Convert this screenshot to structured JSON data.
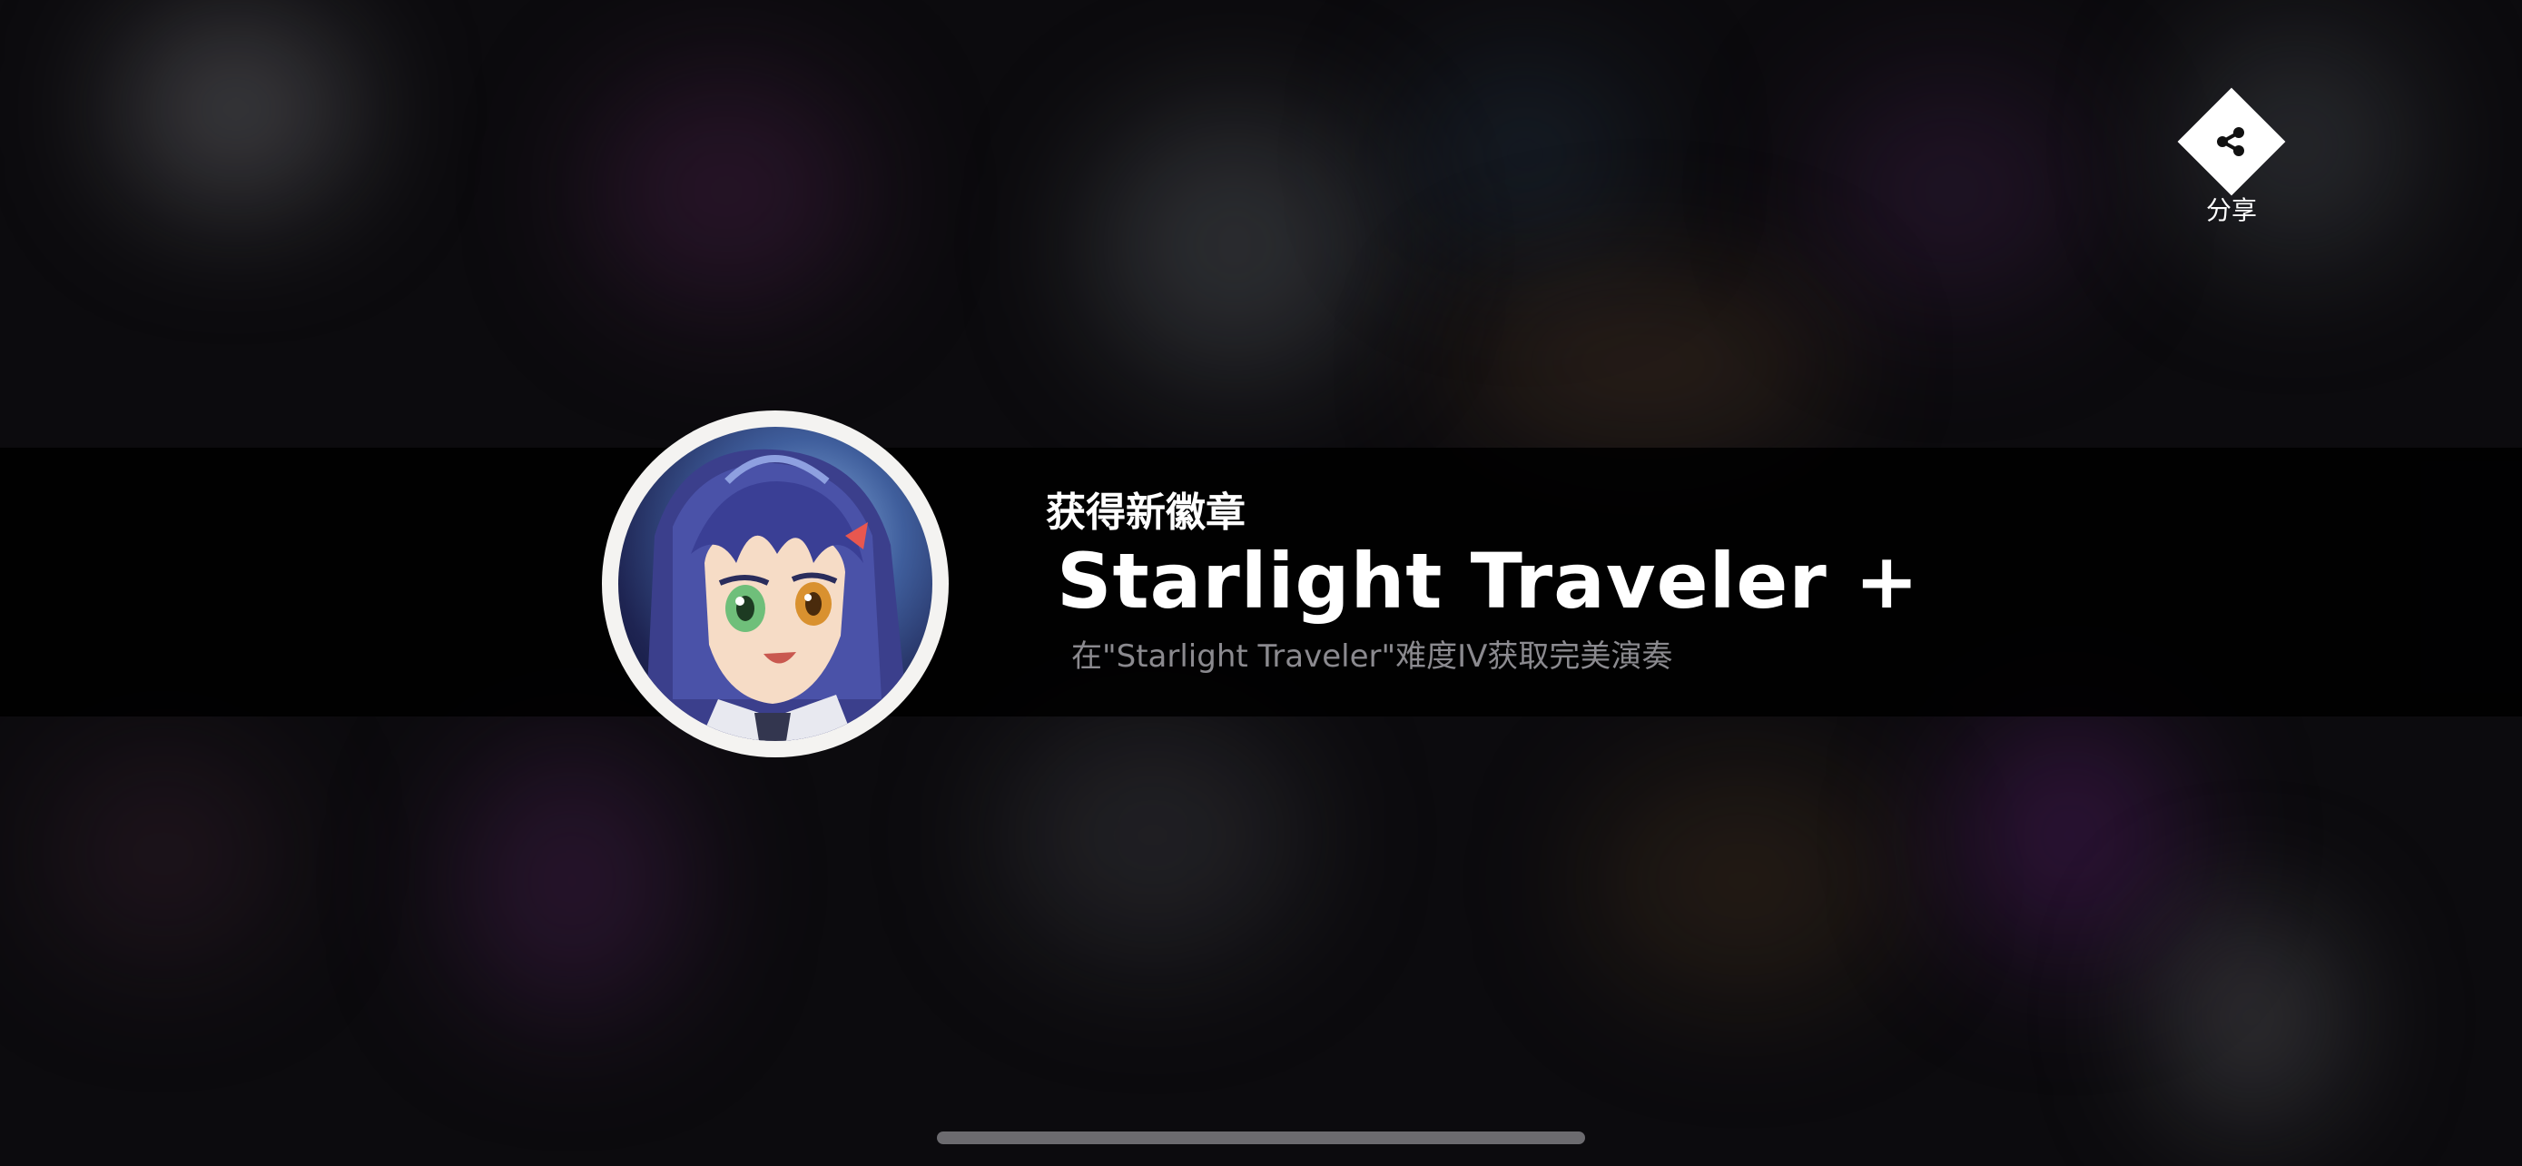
{
  "banner": {
    "eyebrow": "获得新徽章",
    "title": "Starlight Traveler +",
    "description": "在\"Starlight Traveler\"难度IV获取完美演奏"
  },
  "badge": {
    "icon": "character-portrait-badge"
  },
  "share": {
    "label": "分享",
    "icon": "share-icon"
  },
  "colors": {
    "banner_bg": "#000000",
    "title_text": "#ffffff",
    "description_text": "#8b8a8f",
    "badge_ring": "#f4f3f1"
  }
}
